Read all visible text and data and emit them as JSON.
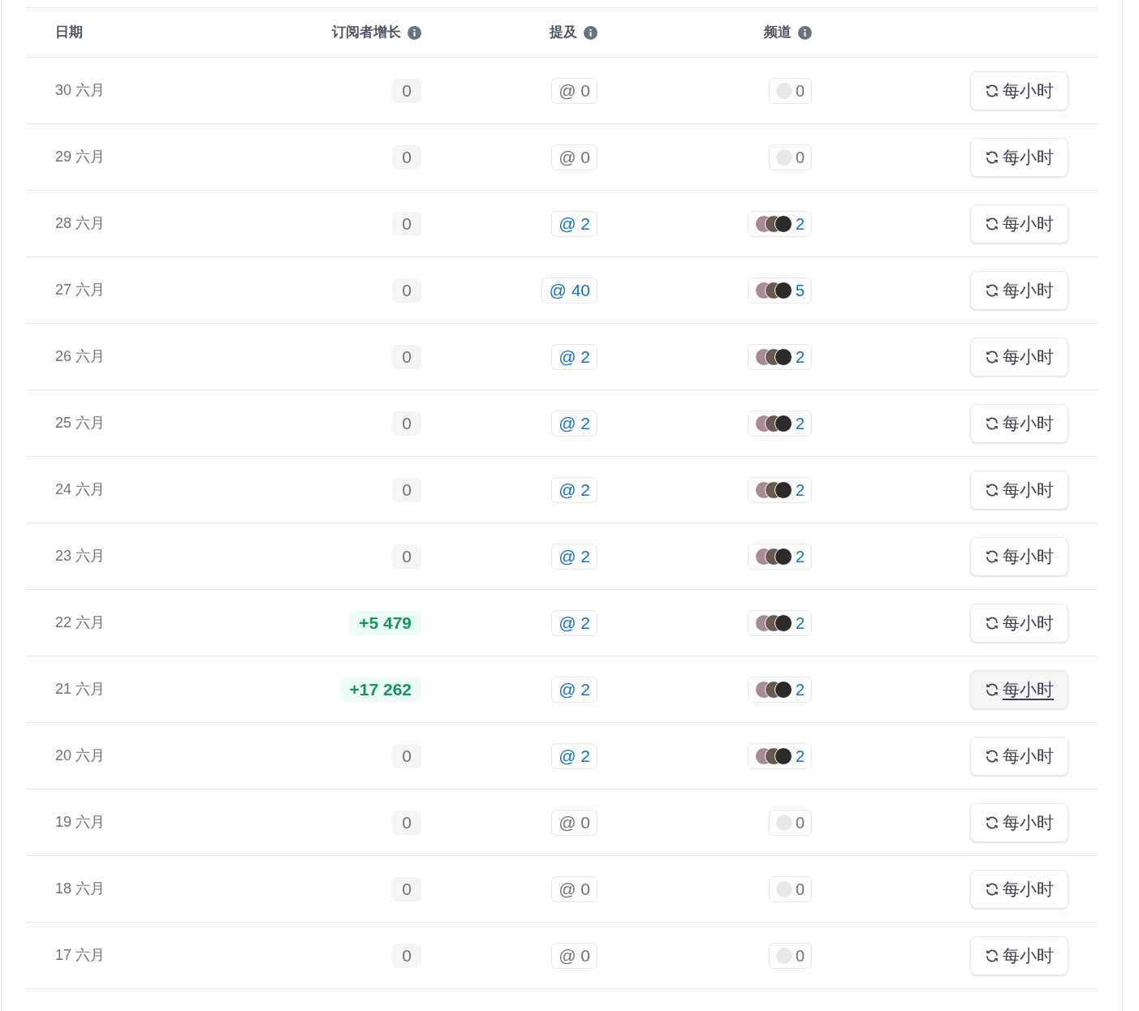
{
  "table": {
    "columns": [
      "日期",
      "订阅者增长",
      "提及",
      "频道"
    ],
    "rows": [
      {
        "date": "30 六月",
        "growth": {
          "value": "0",
          "kind": "zero"
        },
        "mentions": {
          "value": "@ 0",
          "active": false
        },
        "channels": {
          "value": "0",
          "kind": "empty"
        },
        "button": {
          "label": "每小时",
          "hovered": false
        }
      },
      {
        "date": "29 六月",
        "growth": {
          "value": "0",
          "kind": "zero"
        },
        "mentions": {
          "value": "@ 0",
          "active": false
        },
        "channels": {
          "value": "0",
          "kind": "empty"
        },
        "button": {
          "label": "每小时",
          "hovered": false
        }
      },
      {
        "date": "28 六月",
        "growth": {
          "value": "0",
          "kind": "zero"
        },
        "mentions": {
          "value": "@ 2",
          "active": true
        },
        "channels": {
          "value": "2",
          "kind": "avatars"
        },
        "button": {
          "label": "每小时",
          "hovered": false
        }
      },
      {
        "date": "27 六月",
        "growth": {
          "value": "0",
          "kind": "zero"
        },
        "mentions": {
          "value": "@ 40",
          "active": true
        },
        "channels": {
          "value": "5",
          "kind": "avatars"
        },
        "button": {
          "label": "每小时",
          "hovered": false
        }
      },
      {
        "date": "26 六月",
        "growth": {
          "value": "0",
          "kind": "zero"
        },
        "mentions": {
          "value": "@ 2",
          "active": true
        },
        "channels": {
          "value": "2",
          "kind": "avatars"
        },
        "button": {
          "label": "每小时",
          "hovered": false
        }
      },
      {
        "date": "25 六月",
        "growth": {
          "value": "0",
          "kind": "zero"
        },
        "mentions": {
          "value": "@ 2",
          "active": true
        },
        "channels": {
          "value": "2",
          "kind": "avatars"
        },
        "button": {
          "label": "每小时",
          "hovered": false
        }
      },
      {
        "date": "24 六月",
        "growth": {
          "value": "0",
          "kind": "zero"
        },
        "mentions": {
          "value": "@ 2",
          "active": true
        },
        "channels": {
          "value": "2",
          "kind": "avatars"
        },
        "button": {
          "label": "每小时",
          "hovered": false
        }
      },
      {
        "date": "23 六月",
        "growth": {
          "value": "0",
          "kind": "zero"
        },
        "mentions": {
          "value": "@ 2",
          "active": true
        },
        "channels": {
          "value": "2",
          "kind": "avatars"
        },
        "button": {
          "label": "每小时",
          "hovered": false
        }
      },
      {
        "date": "22 六月",
        "growth": {
          "value": "+5 479",
          "kind": "positive"
        },
        "mentions": {
          "value": "@ 2",
          "active": true
        },
        "channels": {
          "value": "2",
          "kind": "avatars"
        },
        "button": {
          "label": "每小时",
          "hovered": false
        }
      },
      {
        "date": "21 六月",
        "growth": {
          "value": "+17 262",
          "kind": "positive"
        },
        "mentions": {
          "value": "@ 2",
          "active": true
        },
        "channels": {
          "value": "2",
          "kind": "avatars"
        },
        "button": {
          "label": "每小时",
          "hovered": true
        }
      },
      {
        "date": "20 六月",
        "growth": {
          "value": "0",
          "kind": "zero"
        },
        "mentions": {
          "value": "@ 2",
          "active": true
        },
        "channels": {
          "value": "2",
          "kind": "avatars"
        },
        "button": {
          "label": "每小时",
          "hovered": false
        }
      },
      {
        "date": "19 六月",
        "growth": {
          "value": "0",
          "kind": "zero"
        },
        "mentions": {
          "value": "@ 0",
          "active": false
        },
        "channels": {
          "value": "0",
          "kind": "empty"
        },
        "button": {
          "label": "每小时",
          "hovered": false
        }
      },
      {
        "date": "18 六月",
        "growth": {
          "value": "0",
          "kind": "zero"
        },
        "mentions": {
          "value": "@ 0",
          "active": false
        },
        "channels": {
          "value": "0",
          "kind": "empty"
        },
        "button": {
          "label": "每小时",
          "hovered": false
        }
      },
      {
        "date": "17 六月",
        "growth": {
          "value": "0",
          "kind": "zero"
        },
        "mentions": {
          "value": "@ 0",
          "active": false
        },
        "channels": {
          "value": "0",
          "kind": "empty"
        },
        "button": {
          "label": "每小时",
          "hovered": false
        }
      }
    ]
  }
}
